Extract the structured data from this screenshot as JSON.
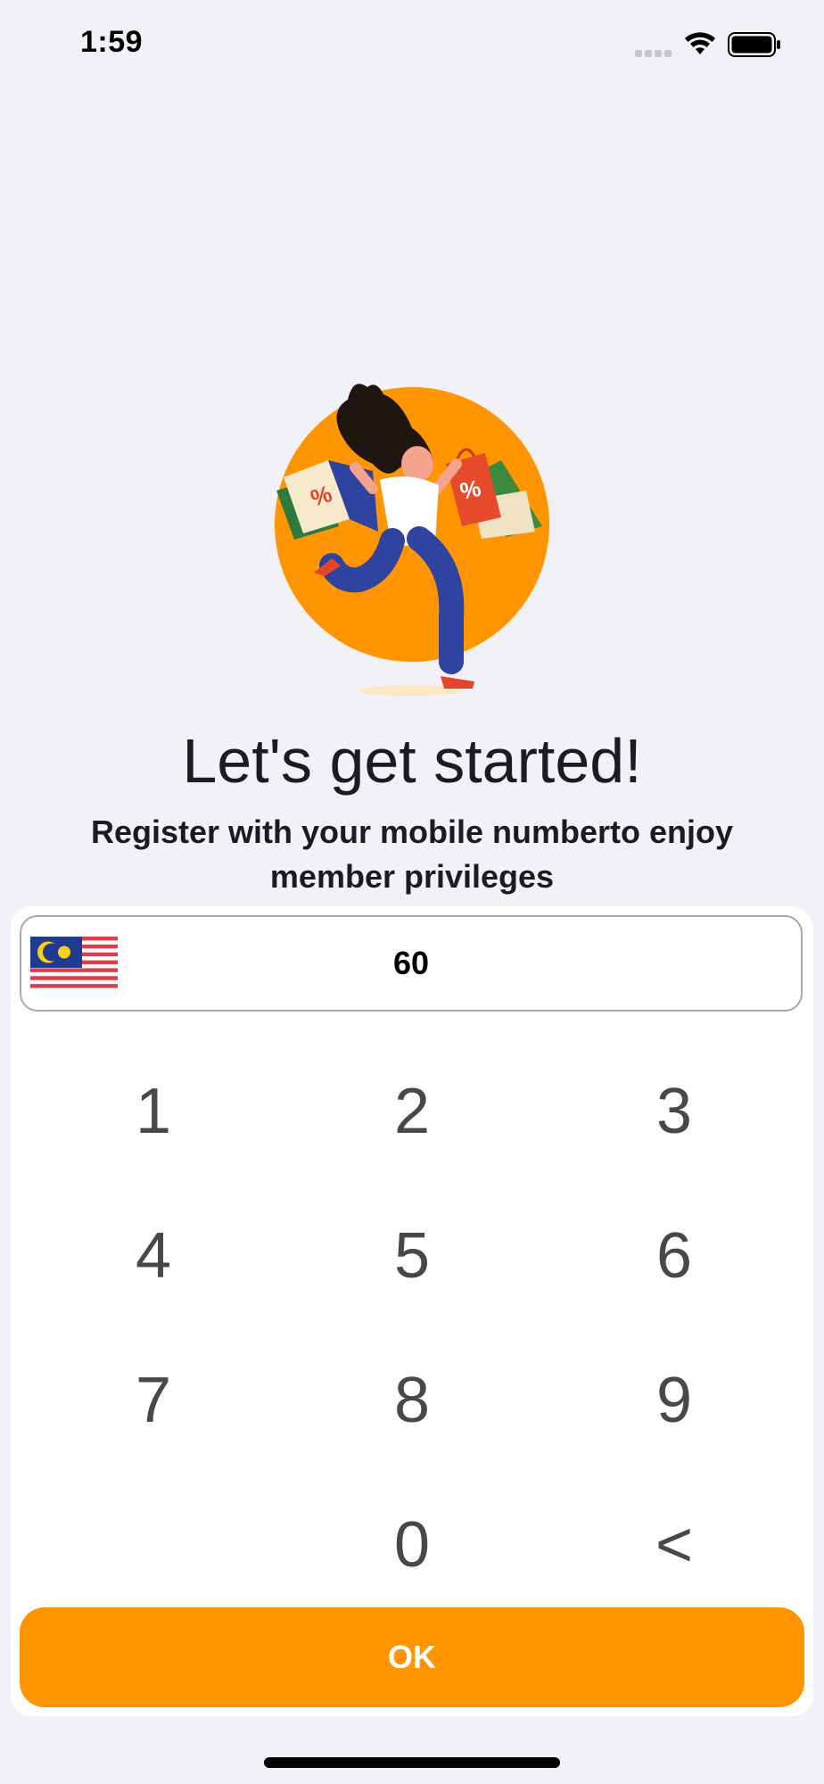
{
  "status_bar": {
    "time": "1:59",
    "icons": [
      "cellular-signal-icon",
      "wifi-icon",
      "battery-icon"
    ]
  },
  "hero": {
    "illustration": "shopping-woman-illustration",
    "bag_labels": [
      "%",
      "%"
    ]
  },
  "headline": "Let's get started!",
  "subtitle": "Register with your mobile numberto enjoy member privileges",
  "phone_input": {
    "country_flag": "malaysia-flag-icon",
    "value": "60"
  },
  "keypad": {
    "keys": [
      "1",
      "2",
      "3",
      "4",
      "5",
      "6",
      "7",
      "8",
      "9",
      "0",
      "<"
    ]
  },
  "ok_button": "OK",
  "colors": {
    "accent": "#ff9500",
    "background": "#f2f1f6",
    "key_text": "#48484a"
  }
}
